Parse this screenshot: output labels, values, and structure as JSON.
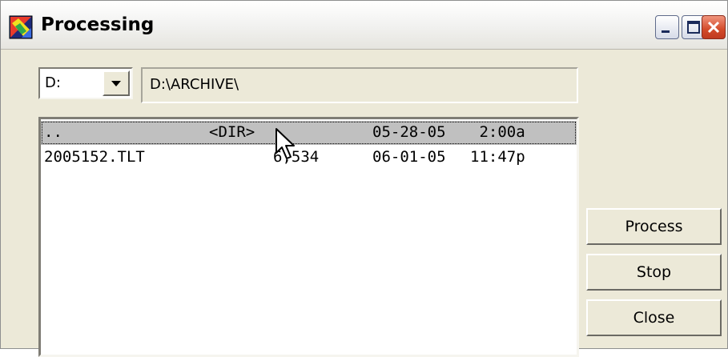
{
  "window": {
    "title": "Processing",
    "icon": "app-icon",
    "title_buttons": [
      "minimize-icon",
      "maximize-icon",
      "close-icon"
    ]
  },
  "drive": {
    "value": "D:"
  },
  "path": {
    "value": "D:\\ARCHIVE\\"
  },
  "file_list": {
    "rows": [
      {
        "name": "..",
        "size": "<DIR>",
        "date": "05-28-05",
        "time": " 2:00a",
        "selected": true
      },
      {
        "name": "2005152.TLT",
        "size": "6,534",
        "date": "06-01-05",
        "time": "11:47p",
        "selected": false
      }
    ]
  },
  "buttons": {
    "process": "Process",
    "stop": "Stop",
    "close": "Close"
  },
  "colors": {
    "dialog_bg": "#ece9d8",
    "selection_bg": "#c0c0c0",
    "close_button": "#d34b2a"
  }
}
